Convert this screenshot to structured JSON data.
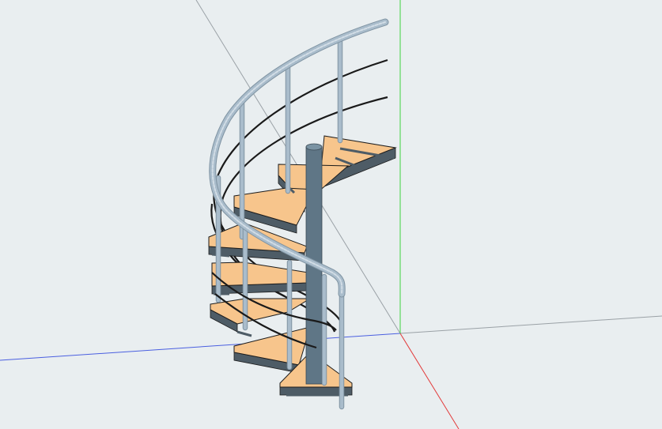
{
  "viewport": {
    "background": "#e9eef0"
  },
  "axes": {
    "x_color": "#e23b3b",
    "y_color": "#4a5fe0",
    "z_color": "#3fd23f",
    "guide_color": "#9aa1a6"
  },
  "model": {
    "tread_color": "#f7c58c",
    "tread_side_color": "#4e5c66",
    "tread_edge_color": "#1c1c1c",
    "column_color": "#5f7686",
    "baluster_color": "#a9bccb",
    "handrail_color": "#a9bccb",
    "cable_color": "#1a1a1a"
  }
}
